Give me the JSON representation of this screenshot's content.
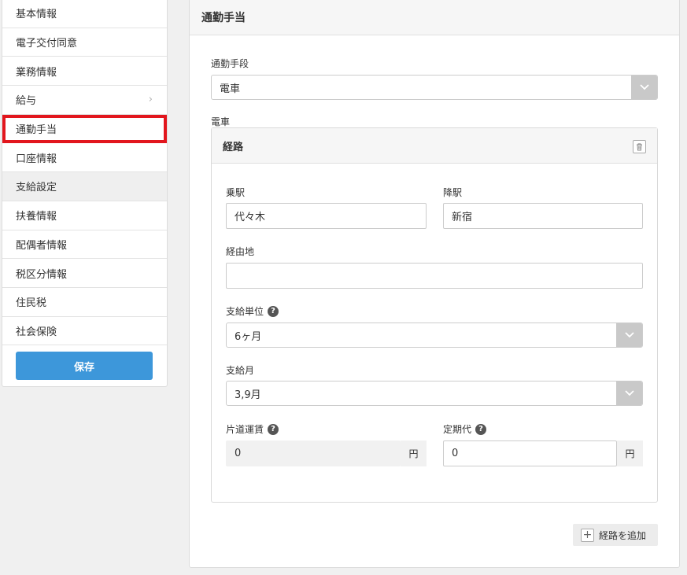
{
  "sidebar": {
    "items": [
      {
        "label": "基本情報",
        "chevron": false
      },
      {
        "label": "電子交付同意",
        "chevron": false
      },
      {
        "label": "業務情報",
        "chevron": false
      },
      {
        "label": "給与",
        "chevron": true
      },
      {
        "label": "通勤手当",
        "chevron": false
      },
      {
        "label": "口座情報",
        "chevron": false
      },
      {
        "label": "支給設定",
        "chevron": false
      },
      {
        "label": "扶養情報",
        "chevron": false
      },
      {
        "label": "配偶者情報",
        "chevron": false
      },
      {
        "label": "税区分情報",
        "chevron": false
      },
      {
        "label": "住民税",
        "chevron": false
      },
      {
        "label": "社会保険",
        "chevron": false
      }
    ],
    "save_label": "保存"
  },
  "panel": {
    "title": "通勤手当",
    "transport_label": "通勤手段",
    "transport_value": "電車",
    "section_label": "電車",
    "route": {
      "title": "経路",
      "board_label": "乗駅",
      "board_value": "代々木",
      "alight_label": "降駅",
      "alight_value": "新宿",
      "via_label": "経由地",
      "via_value": "",
      "unit_label": "支給単位",
      "unit_value": "6ヶ月",
      "month_label": "支給月",
      "month_value": "3,9月",
      "oneway_label": "片道運賃",
      "oneway_value": "0",
      "oneway_unit": "円",
      "pass_label": "定期代",
      "pass_value": "0",
      "pass_unit": "円"
    },
    "add_route_label": "経路を追加"
  },
  "colors": {
    "accent": "#3d97da",
    "highlight": "#e2161d"
  }
}
